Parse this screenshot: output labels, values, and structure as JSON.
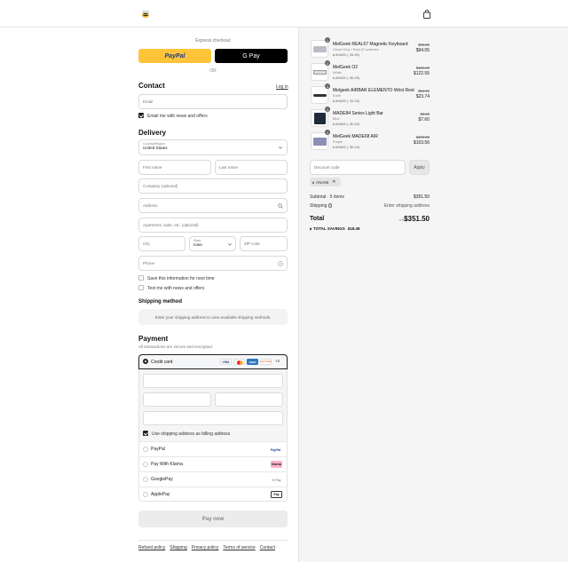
{
  "header": {
    "logo_icon": "bee-logo-icon",
    "bag_icon": "shopping-bag-icon"
  },
  "express": {
    "title": "Express checkout",
    "paypal_label": "PayPal",
    "gpay_label": "G Pay",
    "or_label": "OR"
  },
  "contact": {
    "title": "Contact",
    "login_label": "Log in",
    "email_placeholder": "Email",
    "news_label": "Email me with news and offers"
  },
  "delivery": {
    "title": "Delivery",
    "country_label": "Country/Region",
    "country_value": "United States",
    "first_name_placeholder": "First name",
    "last_name_placeholder": "Last name",
    "company_placeholder": "Company (optional)",
    "address_placeholder": "Address",
    "apartment_placeholder": "Apartment, suite, etc. (optional)",
    "city_placeholder": "City",
    "state_label": "State",
    "state_value": "Iowa",
    "zip_placeholder": "ZIP code",
    "phone_placeholder": "Phone",
    "save_info_label": "Save this information for next time",
    "text_news_label": "Text me with news and offers"
  },
  "shipping": {
    "title": "Shipping method",
    "message": "Enter your shipping address to view available shipping methods."
  },
  "payment": {
    "title": "Payment",
    "subtitle": "All transactions are secure and encrypted.",
    "credit_card_label": "Credit card",
    "card_badges": [
      "VISA",
      "MC",
      "AMEX",
      "DISCOVER",
      "+2"
    ],
    "billing_label": "Use shipping address as billing address",
    "methods": [
      {
        "label": "PayPal",
        "badge": "PayPal"
      },
      {
        "label": "Pay With Klarna",
        "badge": "Klarna"
      },
      {
        "label": "GooglePay",
        "badge": "G Pay"
      },
      {
        "label": "ApplePay",
        "badge": "Pay"
      }
    ],
    "pay_button": "Pay now"
  },
  "footer": {
    "links": [
      "Refund policy",
      "Shipping",
      "Privacy policy",
      "Terms of service",
      "Contact"
    ]
  },
  "summary": {
    "items": [
      {
        "qty": "1",
        "title": "MelGeek REAL67 Magnetic Keyboard",
        "variant": "Ghost Grey / Real-67-switches",
        "discount": "ANA55 (- $4.55)",
        "original": "$98.60",
        "price": "$94.05"
      },
      {
        "qty": "1",
        "title": "MelGeek O2",
        "variant": "White",
        "discount": "ANA55 (- $6.45)",
        "original": "$129.00",
        "price": "$122.55"
      },
      {
        "qty": "1",
        "title": "Melgeek AIRBAR ELEMENTO Wrist Rest",
        "variant": "Earth",
        "discount": "ANA55 (- $1.25)",
        "original": "$24.99",
        "price": "$23.74"
      },
      {
        "qty": "1",
        "title": "MADE84 Series Light Bar",
        "variant": "Blue",
        "discount": "ANA55 (- $0.40)",
        "original": "$8.00",
        "price": "$7.60"
      },
      {
        "qty": "1",
        "title": "MelGeek MADE68 AIR",
        "variant": "Purple",
        "discount": "ANA55 (- $5.44)",
        "original": "$109.00",
        "price": "$103.56"
      }
    ],
    "discount_placeholder": "Discount code",
    "apply_label": "Apply",
    "applied_code": "ANA55",
    "subtotal_label": "Subtotal · 5 items",
    "subtotal_value": "$351.50",
    "shipping_label": "Shipping",
    "shipping_value": "Enter shipping address",
    "total_label": "Total",
    "currency": "USD",
    "total_value": "$351.50",
    "savings_label": "TOTAL SAVINGS",
    "savings_value": "$18.49"
  }
}
